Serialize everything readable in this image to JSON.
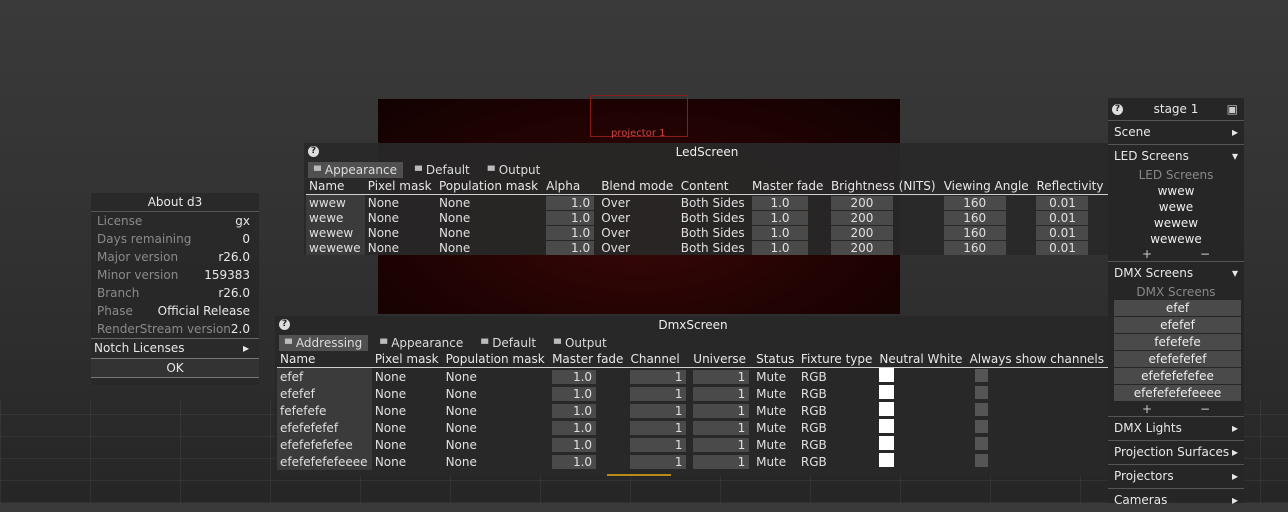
{
  "viewport": {
    "projector_label": "projector 1"
  },
  "about": {
    "title": "About d3",
    "rows": [
      {
        "k": "License",
        "v": "gx"
      },
      {
        "k": "Days remaining",
        "v": "0"
      },
      {
        "k": "Major version",
        "v": "r26.0"
      },
      {
        "k": "Minor version",
        "v": "159383"
      },
      {
        "k": "Branch",
        "v": "r26.0"
      },
      {
        "k": "Phase",
        "v": "Official Release"
      },
      {
        "k": "RenderStream version",
        "v": "2.0"
      }
    ],
    "notch": "Notch Licenses",
    "ok": "OK"
  },
  "led": {
    "title": "LedScreen",
    "tabs": [
      "Appearance",
      "Default",
      "Output"
    ],
    "columns": [
      "Name",
      "Pixel mask",
      "Population mask",
      "Alpha",
      "Blend mode",
      "Content",
      "Master fade",
      "Brightness (NITS)",
      "Viewing Angle",
      "Reflectivity"
    ],
    "rows": [
      [
        "wwew",
        "None",
        "None",
        "1.0",
        "Over",
        "Both Sides",
        "1.0",
        "200",
        "160",
        "0.01"
      ],
      [
        "wewe",
        "None",
        "None",
        "1.0",
        "Over",
        "Both Sides",
        "1.0",
        "200",
        "160",
        "0.01"
      ],
      [
        "wewew",
        "None",
        "None",
        "1.0",
        "Over",
        "Both Sides",
        "1.0",
        "200",
        "160",
        "0.01"
      ],
      [
        "wewewe",
        "None",
        "None",
        "1.0",
        "Over",
        "Both Sides",
        "1.0",
        "200",
        "160",
        "0.01"
      ]
    ]
  },
  "dmx": {
    "title": "DmxScreen",
    "tabs": [
      "Addressing",
      "Appearance",
      "Default",
      "Output"
    ],
    "columns": [
      "Name",
      "Pixel mask",
      "Population mask",
      "Master fade",
      "Channel",
      "Universe",
      "Status",
      "Fixture type",
      "Neutral White",
      "Always show channels"
    ],
    "rows": [
      [
        "efef",
        "None",
        "None",
        "1.0",
        "1",
        "1",
        "Mute",
        "RGB"
      ],
      [
        "efefef",
        "None",
        "None",
        "1.0",
        "1",
        "1",
        "Mute",
        "RGB"
      ],
      [
        "fefefefe",
        "None",
        "None",
        "1.0",
        "1",
        "1",
        "Mute",
        "RGB"
      ],
      [
        "efefefefef",
        "None",
        "None",
        "1.0",
        "1",
        "1",
        "Mute",
        "RGB"
      ],
      [
        "efefefefefee",
        "None",
        "None",
        "1.0",
        "1",
        "1",
        "Mute",
        "RGB"
      ],
      [
        "efefefefefeeee",
        "None",
        "None",
        "1.0",
        "1",
        "1",
        "Mute",
        "RGB"
      ]
    ]
  },
  "sidebar": {
    "title": "stage 1",
    "scene": "Scene",
    "led_screens": {
      "label": "LED Screens",
      "sub": "LED Screens",
      "items": [
        "wwew",
        "wewe",
        "wewew",
        "wewewe"
      ]
    },
    "dmx_screens": {
      "label": "DMX Screens",
      "sub": "DMX Screens",
      "items": [
        "efef",
        "efefef",
        "fefefefe",
        "efefefefef",
        "efefefefefee",
        "efefefefefeeee"
      ]
    },
    "plus": "+",
    "minus": "−",
    "dmx_lights": "DMX Lights",
    "projection_surfaces": "Projection Surfaces",
    "projectors": "Projectors",
    "cameras": "Cameras"
  }
}
